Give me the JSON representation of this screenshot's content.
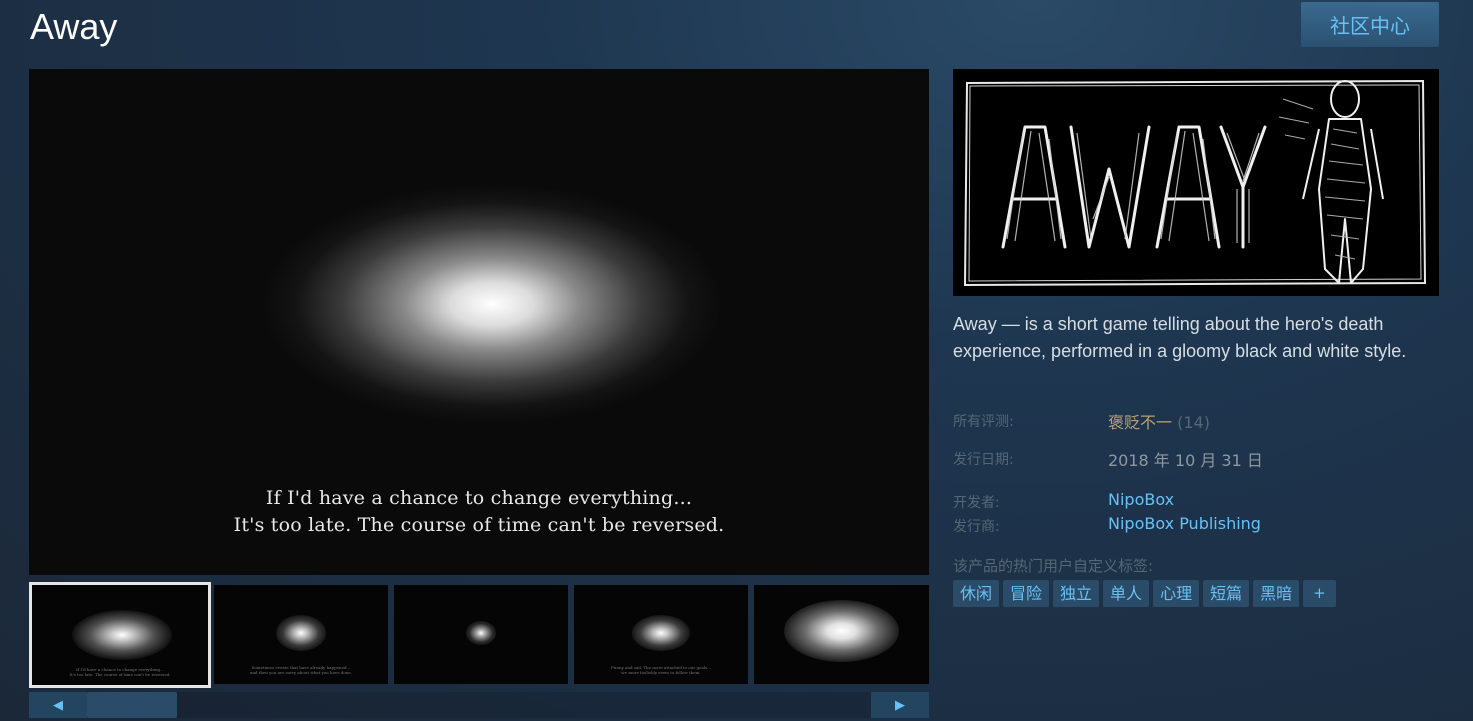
{
  "header": {
    "game_title": "Away",
    "community_hub_label": "社区中心"
  },
  "media": {
    "main_caption_line1": "If I'd have a chance to change everything...",
    "main_caption_line2": "It's too late. The course of time can't be reversed.",
    "thumbnails": [
      {
        "label": "screenshot-1",
        "selected": true
      },
      {
        "label": "screenshot-2",
        "selected": false
      },
      {
        "label": "screenshot-3",
        "selected": false
      },
      {
        "label": "screenshot-4",
        "selected": false
      },
      {
        "label": "screenshot-5",
        "selected": false
      }
    ],
    "scroll_left_icon": "◀",
    "scroll_right_icon": "▶"
  },
  "capsule": {
    "logo_text": "AWAY"
  },
  "description": "Away — is a short game telling about the hero's death experience, performed in a gloomy black and white style.",
  "meta": {
    "reviews_label": "所有评测:",
    "reviews_value": "褒贬不一",
    "reviews_count": "(14)",
    "release_label": "发行日期:",
    "release_value": "2018 年 10 月 31 日",
    "developer_label": "开发者:",
    "developer_value": "NipoBox",
    "publisher_label": "发行商:",
    "publisher_value": "NipoBox Publishing"
  },
  "tags": {
    "title": "该产品的热门用户自定义标签:",
    "items": [
      "休闲",
      "冒险",
      "独立",
      "单人",
      "心理",
      "短篇",
      "黑暗"
    ],
    "more_label": "+"
  },
  "colors": {
    "accent_link": "#67c1f5",
    "review_mixed": "#b9a074",
    "background": "#1b2838"
  }
}
